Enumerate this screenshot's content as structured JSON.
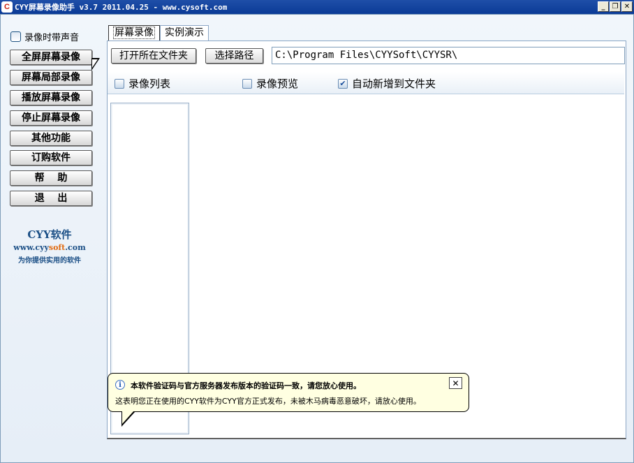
{
  "window": {
    "title": "CYY屏幕录像助手 v3.7 2011.04.25 - www.cysoft.com",
    "app_icon": "cyy-app-icon",
    "controls": [
      "minimize-icon",
      "restore-icon",
      "close-icon"
    ]
  },
  "sidebar": {
    "record_sound_label": "录像时带声音",
    "record_sound_checked": false,
    "buttons": [
      {
        "label": "全屏屏幕录像"
      },
      {
        "label": "屏幕局部录像"
      },
      {
        "label": "播放屏幕录像"
      },
      {
        "label": "停止屏幕录像"
      },
      {
        "label": "其他功能"
      },
      {
        "label": "订购软件"
      },
      {
        "label": "帮　 助"
      },
      {
        "label": "退　 出"
      }
    ],
    "brand": {
      "name": "CYY软件",
      "url_prefix": "www.cyy",
      "url_highlight": "soft",
      "url_suffix": ".com",
      "slogan": "为你提供实用的软件"
    }
  },
  "tabs": [
    {
      "label": "屏幕录像",
      "active": true
    },
    {
      "label": "实例演示",
      "active": false
    }
  ],
  "toolbar": {
    "open_folder_label": "打开所在文件夹",
    "choose_path_label": "选择路径",
    "path_value": "C:\\Program Files\\CYYSoft\\CYYSR\\"
  },
  "options": {
    "list_label": "录像列表",
    "preview_label": "录像预览",
    "auto_add_label": "自动新增到文件夹",
    "auto_add_checked": true
  },
  "balloon": {
    "title": "本软件验证码与官方服务器发布版本的验证码一致，请您放心使用。",
    "text": "这表明您正在使用的CYY软件为CYY官方正式发布，未被木马病毒恶意破坏，请放心使用。",
    "close_glyph": "✕"
  },
  "colors": {
    "title_bar": "#0a3a96",
    "brand_blue": "#1b4f86",
    "brand_orange": "#e06a10",
    "balloon_bg": "#ffffe1"
  }
}
